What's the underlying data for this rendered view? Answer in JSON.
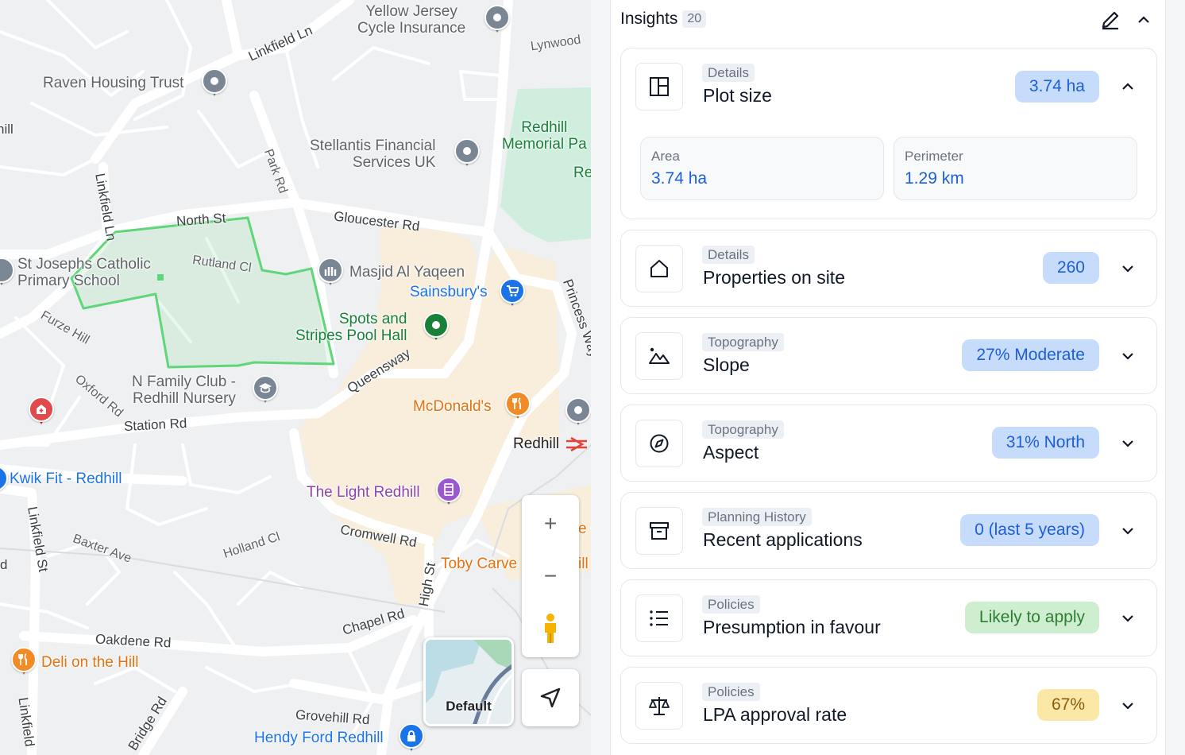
{
  "map": {
    "places": {
      "yellow_jersey": "Yellow Jersey\nCycle Insurance",
      "raven_housing": "Raven Housing Trust",
      "stellantis": "Stellantis Financial\nServices UK",
      "redhill_memorial": "Redhill\nMemorial Pa",
      "redhill_memorial_re": "Re",
      "st_josephs": "St Josephs Catholic\nPrimary School",
      "masjid": "Masjid Al Yaqeen",
      "sainsburys": "Sainsbury's",
      "spots_stripes": "Spots and\nStripes Pool Hall",
      "n_family": "N Family Club -\nRedhill Nursery",
      "mcdonalds": "McDonald's",
      "redhill_station": "Redhill",
      "kwik_fit": "Kwik Fit - Redhill",
      "light_redhill": "The Light Redhill",
      "toby_carvery": "Toby Carve",
      "toby_carvery_tail": "ill",
      "deli": "Deli on the Hill",
      "hendy_ford": "Hendy Ford Redhill",
      "edge_c": "e C"
    },
    "roads": {
      "linkfield_ln_top": "Linkfield Ln",
      "lynwood": "Lynwood",
      "hill_left": "hill",
      "park_rd": "Park Rd",
      "north_st": "North St",
      "gloucester_rd": "Gloucester Rd",
      "linkfield_ln_left": "Linkfield Ln",
      "rutland_cl": "Rutland Cl",
      "princess_way": "Princess Way",
      "furze_hill": "Furze Hill",
      "queensway": "Queensway",
      "oxford_rd": "Oxford Rd",
      "station_rd": "Station Rd",
      "linkfield_st": "Linkfield St",
      "baxter_ave": "Baxter Ave",
      "holland_cl": "Holland Cl",
      "cromwell_rd": "Cromwell Rd",
      "high_st": "High St",
      "chapel_rd": "Chapel Rd",
      "oakdene_rd": "Oakdene Rd",
      "bridge_rd": "Bridge Rd",
      "grovehill_rd": "Grovehill Rd",
      "linkfield_bottom": "Linkfield",
      "d_left": "d"
    },
    "controls": {
      "zoom_in": "+",
      "zoom_out": "−",
      "layer_label": "Default"
    }
  },
  "panel": {
    "title": "Insights",
    "count": "20",
    "cards": [
      {
        "category": "Details",
        "name": "Plot size",
        "value": "3.74 ha",
        "tone": "blue",
        "icon": "layout-icon",
        "expanded": true,
        "metrics": [
          {
            "label": "Area",
            "value": "3.74 ha"
          },
          {
            "label": "Perimeter",
            "value": "1.29 km"
          }
        ]
      },
      {
        "category": "Details",
        "name": "Properties on site",
        "value": "260",
        "tone": "blue",
        "icon": "house-icon",
        "expanded": false
      },
      {
        "category": "Topography",
        "name": "Slope",
        "value": "27% Moderate",
        "tone": "blue",
        "icon": "mountain-icon",
        "expanded": false
      },
      {
        "category": "Topography",
        "name": "Aspect",
        "value": "31% North",
        "tone": "blue",
        "icon": "compass-icon",
        "expanded": false
      },
      {
        "category": "Planning History",
        "name": "Recent applications",
        "value": "0 (last 5 years)",
        "tone": "blue",
        "icon": "archive-icon",
        "expanded": false
      },
      {
        "category": "Policies",
        "name": "Presumption in favour",
        "value": "Likely to apply",
        "tone": "green",
        "icon": "list-icon",
        "expanded": false
      },
      {
        "category": "Policies",
        "name": "LPA approval rate",
        "value": "67%",
        "tone": "yellow",
        "icon": "scales-icon",
        "expanded": false
      }
    ]
  },
  "colors": {
    "map_bg": "#eff0f2",
    "park": "#cfeedd",
    "urban": "#f8eedb",
    "plot_outline": "#5fd67a",
    "accent_blue": "#1d5fd6"
  }
}
